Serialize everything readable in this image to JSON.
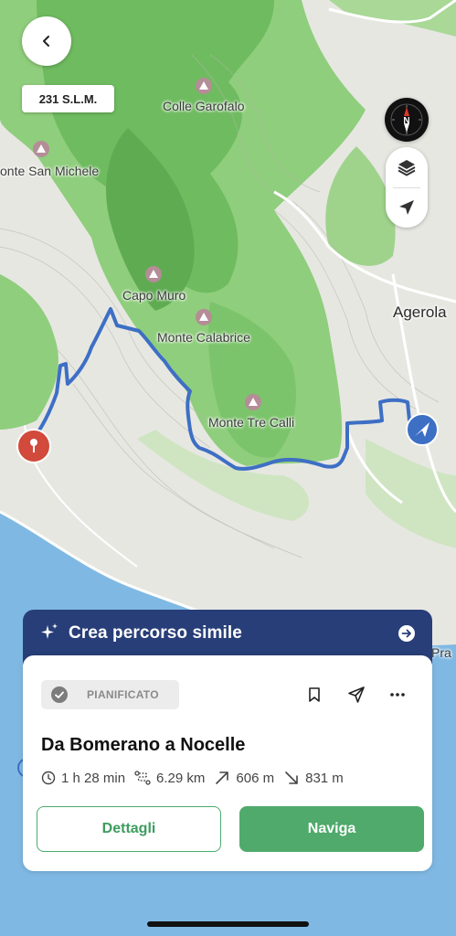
{
  "map": {
    "altitude": "231 S.L.M.",
    "labels": {
      "colle_garofalo": "Colle Garofalo",
      "monte_san_michele": "onte San Michele",
      "capo_muro": "Capo Muro",
      "monte_calabrice": "Monte Calabrice",
      "monte_tre_calli": "Monte Tre Calli",
      "agerola": "Agerola",
      "pra": "Pra"
    }
  },
  "banner": {
    "label": "Crea percorso simile"
  },
  "route": {
    "status": "PIANIFICATO",
    "title": "Da Bomerano a Nocelle",
    "duration": "1 h 28 min",
    "distance": "6.29 km",
    "ascent": "606 m",
    "descent": "831 m"
  },
  "buttons": {
    "details": "Dettagli",
    "navigate": "Naviga"
  },
  "colors": {
    "route": "#3d6fc4",
    "accent": "#4faa6b",
    "banner": "#283e78",
    "start_pin": "#d24a3c"
  },
  "icons": [
    "back-icon",
    "compass-icon",
    "layers-icon",
    "location-arrow-icon",
    "sparkle-icon",
    "arrow-right-circle-icon",
    "check-circle-icon",
    "bookmark-icon",
    "send-icon",
    "more-icon",
    "clock-icon",
    "route-icon",
    "ascent-icon",
    "descent-icon"
  ]
}
